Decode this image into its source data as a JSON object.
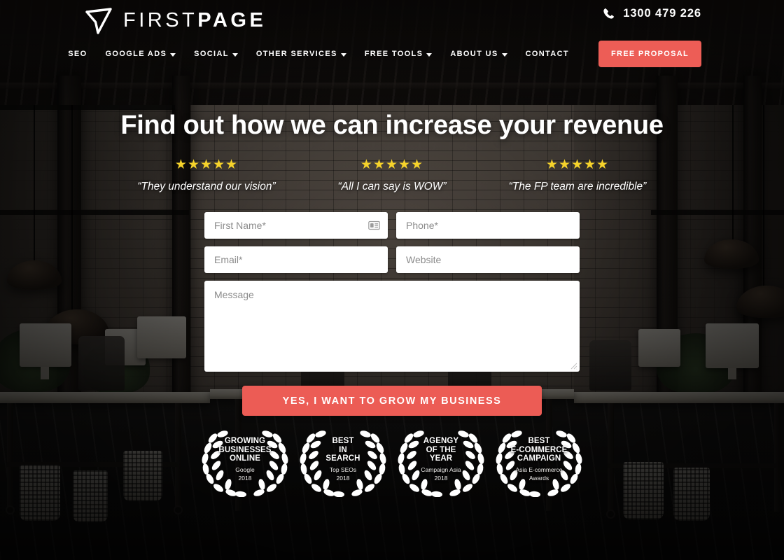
{
  "brand": {
    "logo_thin": "FIRST",
    "logo_bold": "PAGE",
    "logo_icon": "paper-plane-icon",
    "accent_color": "#ec5c55",
    "star_color": "#f6cf2a"
  },
  "header": {
    "phone_icon": "phone-icon",
    "phone_number": "1300 479 226",
    "nav_items": [
      {
        "label": "SEO",
        "has_dropdown": false
      },
      {
        "label": "GOOGLE ADS",
        "has_dropdown": true
      },
      {
        "label": "SOCIAL",
        "has_dropdown": true
      },
      {
        "label": "OTHER SERVICES",
        "has_dropdown": true
      },
      {
        "label": "FREE TOOLS",
        "has_dropdown": true
      },
      {
        "label": "ABOUT US",
        "has_dropdown": true
      },
      {
        "label": "CONTACT",
        "has_dropdown": false
      }
    ],
    "cta_label": "FREE PROPOSAL"
  },
  "hero": {
    "headline": "Find out how we can increase your revenue",
    "reviews": [
      {
        "stars": "★★★★★",
        "rating": 5,
        "quote": "“They understand our vision”"
      },
      {
        "stars": "★★★★★",
        "rating": 5,
        "quote": "“All I can say is WOW”"
      },
      {
        "stars": "★★★★★",
        "rating": 5,
        "quote": "“The FP team are incredible”"
      }
    ]
  },
  "form": {
    "first_name": {
      "placeholder": "First Name*",
      "value": "",
      "icon": "autofill-contact-card-icon"
    },
    "phone": {
      "placeholder": "Phone*",
      "value": ""
    },
    "email": {
      "placeholder": "Email*",
      "value": ""
    },
    "website": {
      "placeholder": "Website",
      "value": ""
    },
    "message": {
      "placeholder": "Message",
      "value": ""
    },
    "submit_label": "YES, I WANT TO GROW MY BUSINESS"
  },
  "awards": [
    {
      "title_lines": [
        "GROWING",
        "BUSINESSES",
        "ONLINE"
      ],
      "sub_lines": [
        "Google",
        "2018"
      ]
    },
    {
      "title_lines": [
        "BEST",
        "IN",
        "SEARCH"
      ],
      "sub_lines": [
        "Top SEOs",
        "2018"
      ]
    },
    {
      "title_lines": [
        "AGENGY",
        "OF THE",
        "YEAR"
      ],
      "sub_lines": [
        "Campaign Asia",
        "2018"
      ]
    },
    {
      "title_lines": [
        "BEST",
        "E-COMMERCE",
        "CAMPAIGN"
      ],
      "sub_lines": [
        "Asia E-commerce",
        "Awards"
      ]
    }
  ]
}
